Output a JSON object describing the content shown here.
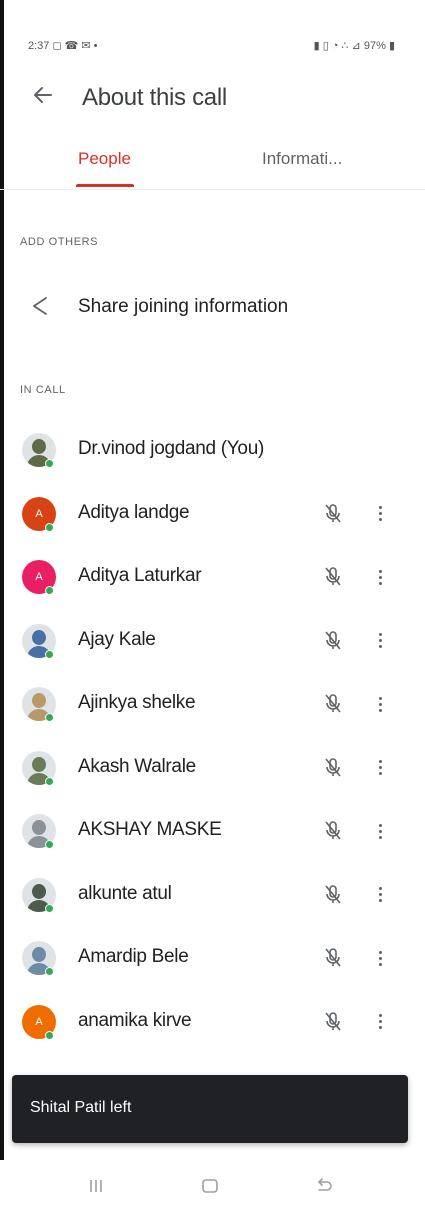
{
  "status_bar": {
    "left": "2:37 ◻ ☎ ✉ •",
    "right": "▮ ▯ ◔ ∴ ⊿ 97% ▮"
  },
  "header": {
    "back_icon": "arrow-back-icon",
    "title": "About this call"
  },
  "tabs": [
    {
      "label": "People",
      "active": true
    },
    {
      "label": "Informati...",
      "active": false
    }
  ],
  "sections": {
    "add_others": "ADD OTHERS",
    "share_label": "Share joining information",
    "share_icon": "share-icon",
    "in_call": "IN CALL"
  },
  "participants": [
    {
      "name": "Dr.vinod jogdand (You)",
      "avatar": "photo",
      "avatar_color": "#5d6b4a",
      "show_controls": false
    },
    {
      "name": "Aditya landge",
      "avatar": "initial",
      "initial": "A",
      "avatar_color": "#d84315",
      "show_controls": true
    },
    {
      "name": "Aditya Laturkar",
      "avatar": "initial",
      "initial": "A",
      "avatar_color": "#e91e63",
      "show_controls": true
    },
    {
      "name": "Ajay Kale",
      "avatar": "photo",
      "avatar_color": "#4a6fa5",
      "show_controls": true
    },
    {
      "name": "Ajinkya shelke",
      "avatar": "photo",
      "avatar_color": "#b89a6a",
      "show_controls": true
    },
    {
      "name": "Akash Walrale",
      "avatar": "photo",
      "avatar_color": "#6b7a58",
      "show_controls": true
    },
    {
      "name": "AKSHAY MASKE",
      "avatar": "photo",
      "avatar_color": "#8a9298",
      "show_controls": true
    },
    {
      "name": "alkunte atul",
      "avatar": "photo",
      "avatar_color": "#4e5a4a",
      "show_controls": true
    },
    {
      "name": "Amardip Bele",
      "avatar": "photo",
      "avatar_color": "#6d8aa8",
      "show_controls": true
    },
    {
      "name": "anamika kirve",
      "avatar": "initial",
      "initial": "A",
      "avatar_color": "#ef6c00",
      "show_controls": true
    }
  ],
  "toast": {
    "message": "Shital Patil left"
  },
  "colors": {
    "accent": "#d93025",
    "presence": "#34a853",
    "icon_grey": "#5f6368"
  }
}
